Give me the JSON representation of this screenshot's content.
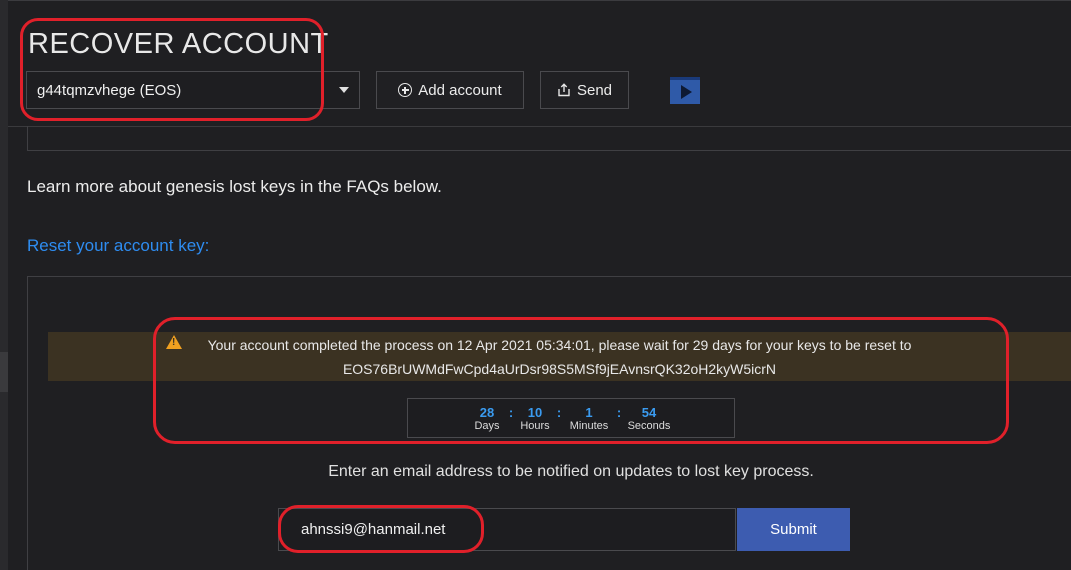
{
  "page": {
    "title": "RECOVER ACCOUNT"
  },
  "toolbar": {
    "account_selected": "g44tqmzvhege (EOS)",
    "add_account_label": "Add account",
    "send_label": "Send"
  },
  "content": {
    "learn_more_text": "Learn more about genesis lost keys in the FAQs below.",
    "reset_link_text": "Reset your account key:"
  },
  "alert": {
    "line1": "Your account completed the process on 12 Apr 2021 05:34:01, please wait for 29 days for your keys to be reset to",
    "line2": "EOS76BrUWMdFwCpd4aUrDsr98S5MSf9jEAvnsrQK32oH2kyW5icrN"
  },
  "countdown": {
    "days": "28",
    "hours": "10",
    "minutes": "1",
    "seconds": "54",
    "days_label": "Days",
    "hours_label": "Hours",
    "minutes_label": "Minutes",
    "seconds_label": "Seconds",
    "separator": ":"
  },
  "notify": {
    "text": "Enter an email address to be notified on updates to lost key process.",
    "email_value": "ahnssi9@hanmail.net",
    "submit_label": "Submit"
  },
  "colors": {
    "link": "#2e8cf0",
    "submit_bg": "#3d5cb0",
    "alert_bg": "#3b3222",
    "annotation": "#e0202a"
  }
}
